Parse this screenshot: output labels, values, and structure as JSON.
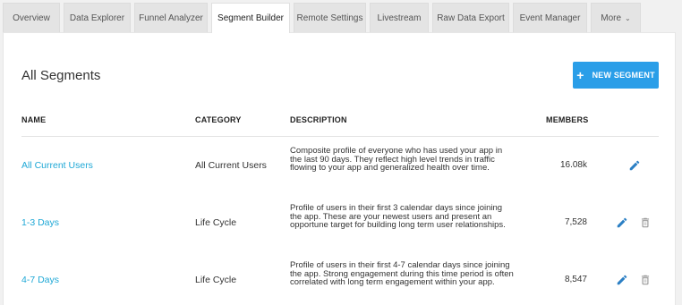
{
  "tabs": [
    {
      "label": "Overview"
    },
    {
      "label": "Data Explorer"
    },
    {
      "label": "Funnel Analyzer"
    },
    {
      "label": "Segment Builder",
      "active": true
    },
    {
      "label": "Remote Settings"
    },
    {
      "label": "Livestream"
    },
    {
      "label": "Raw Data Export"
    },
    {
      "label": "Event Manager"
    },
    {
      "label": "More"
    }
  ],
  "page": {
    "title": "All Segments",
    "new_button_label": "NEW SEGMENT"
  },
  "table": {
    "headers": {
      "name": "NAME",
      "category": "CATEGORY",
      "description": "DESCRIPTION",
      "members": "MEMBERS"
    },
    "rows": [
      {
        "name": "All Current Users",
        "category": "All Current Users",
        "description": "Composite profile of everyone who has used your app in the last 90 days. They reflect high level trends in traffic flowing to your app and generalized health over time.",
        "members": "16.08k",
        "deletable": false
      },
      {
        "name": "1-3 Days",
        "category": "Life Cycle",
        "description": "Profile of users in their first 3 calendar days since joining the app. These are your newest users and present an opportune target for building long term user relationships.",
        "members": "7,528",
        "deletable": true
      },
      {
        "name": "4-7 Days",
        "category": "Life Cycle",
        "description": "Profile of users in their first 4-7 calendar days since joining the app. Strong engagement during this time period is often correlated with long term engagement within your app.",
        "members": "8,547",
        "deletable": true
      }
    ]
  },
  "colors": {
    "accent": "#2a9ee8",
    "link": "#1fa8d6",
    "edit_icon": "#2b7fc4",
    "delete_icon": "#9a9a9a"
  },
  "icons": {
    "add": "plus-icon",
    "edit": "pencil-icon",
    "delete": "trash-icon",
    "more": "chevron-down-icon"
  }
}
